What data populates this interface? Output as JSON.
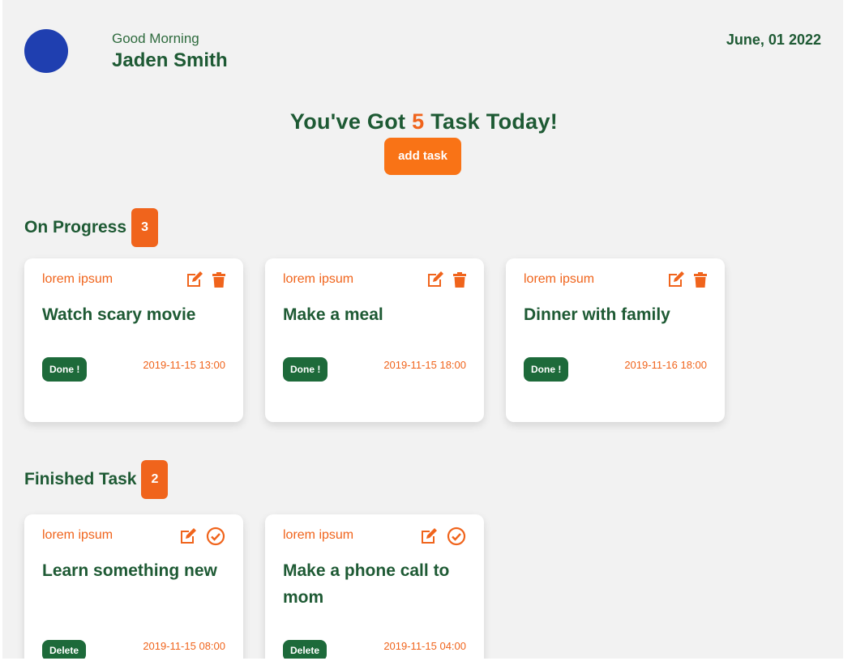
{
  "header": {
    "greeting": "Good Morning",
    "user_name": "Jaden Smith",
    "date": "June, 01 2022"
  },
  "summary": {
    "prefix": "You've Got ",
    "count": "5",
    "suffix": " Task Today!",
    "add_label": "add task"
  },
  "colors": {
    "accent": "#f0641c",
    "primary": "#1e5a34",
    "avatar": "#1f3fb0",
    "background": "#f2f2f2"
  },
  "on_progress": {
    "title": "On Progress",
    "count": "3",
    "tasks": [
      {
        "category": "lorem ipsum",
        "title": "Watch scary movie",
        "status": "Done !",
        "time": "2019-11-15 13:00"
      },
      {
        "category": "lorem ipsum",
        "title": "Make a meal",
        "status": "Done !",
        "time": "2019-11-15 18:00"
      },
      {
        "category": "lorem ipsum",
        "title": "Dinner with family",
        "status": "Done !",
        "time": "2019-11-16 18:00"
      }
    ]
  },
  "finished": {
    "title": "Finished Task",
    "count": "2",
    "tasks": [
      {
        "category": "lorem ipsum",
        "title": "Learn something new",
        "status": "Delete",
        "time": "2019-11-15 08:00"
      },
      {
        "category": "lorem ipsum",
        "title": "Make a phone call to mom",
        "status": "Delete",
        "time": "2019-11-15 04:00"
      }
    ]
  },
  "icons": {
    "edit": "edit-icon",
    "delete": "trash-icon",
    "complete": "check-circle-icon"
  }
}
